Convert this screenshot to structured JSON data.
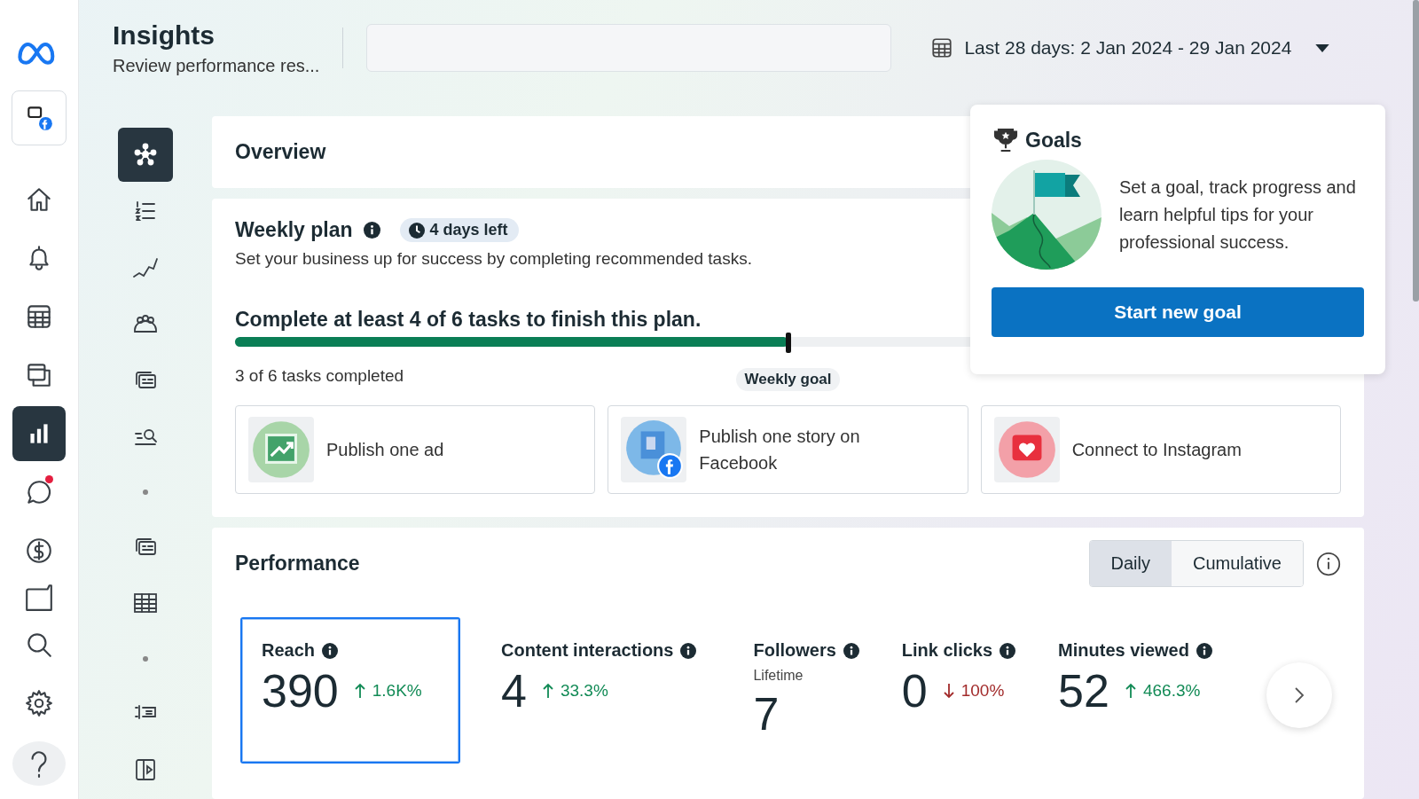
{
  "rail": [
    {
      "selected": false,
      "badge": false
    },
    {
      "selected": false,
      "badge": false
    },
    {
      "selected": false,
      "badge": false
    },
    {
      "selected": false,
      "badge": false
    },
    {
      "selected": true,
      "badge": false
    },
    {
      "selected": false,
      "badge": true
    },
    {
      "selected": false,
      "badge": false
    },
    {
      "selected": false,
      "badge": false
    },
    {
      "selected": false,
      "badge": false
    },
    {
      "selected": false,
      "badge": false
    },
    {
      "selected": false,
      "badge": false
    }
  ],
  "secondary_nav": [
    {
      "kind": "icon",
      "selected": true
    },
    {
      "kind": "icon",
      "selected": false
    },
    {
      "kind": "icon",
      "selected": false
    },
    {
      "kind": "icon",
      "selected": false
    },
    {
      "kind": "icon",
      "selected": false
    },
    {
      "kind": "icon",
      "selected": false
    },
    {
      "kind": "dot"
    },
    {
      "kind": "icon",
      "selected": false
    },
    {
      "kind": "icon",
      "selected": false
    },
    {
      "kind": "dot"
    },
    {
      "kind": "icon",
      "selected": false
    },
    {
      "kind": "icon",
      "selected": false
    }
  ],
  "header": {
    "title": "Insights",
    "subtitle": "Review performance res...",
    "date_range": "Last 28 days: 2 Jan 2024 - 29 Jan 2024"
  },
  "overview": {
    "title": "Overview"
  },
  "weekly_plan": {
    "title": "Weekly plan",
    "badge": "4 days left",
    "description": "Set your business up for success by completing recommended tasks.",
    "goal_text": "Complete at least 4 of 6 tasks to finish this plan.",
    "level": 0.5,
    "progress_text": "3 of 6 tasks completed",
    "marker_label": "Weekly goal",
    "tasks": [
      {
        "kind": "ad",
        "label": "Publish one ad"
      },
      {
        "kind": "story",
        "label": "Publish one story on Facebook"
      },
      {
        "kind": "instagram",
        "label": "Connect to Instagram"
      }
    ]
  },
  "goals": {
    "title": "Goals",
    "text": "Set a goal, track progress and learn helpful tips for your professional success.",
    "button": "Start new goal"
  },
  "performance": {
    "title": "Performance",
    "toggle": [
      {
        "label": "Daily",
        "selected": true
      },
      {
        "label": "Cumulative",
        "selected": false
      }
    ],
    "metrics": [
      {
        "label": "Reach",
        "value": "390",
        "change": "1.6K%",
        "rising": true,
        "selected": true
      },
      {
        "label": "Content interactions",
        "value": "4",
        "change": "33.3%",
        "rising": true,
        "selected": false
      },
      {
        "label": "Followers",
        "subtitle": "Lifetime",
        "value": "7",
        "selected": false
      },
      {
        "label": "Link clicks",
        "value": "0",
        "change": "100%",
        "rising": false,
        "selected": false
      },
      {
        "label": "Minutes viewed",
        "value": "52",
        "change": "466.3%",
        "rising": true,
        "selected": false
      }
    ]
  }
}
